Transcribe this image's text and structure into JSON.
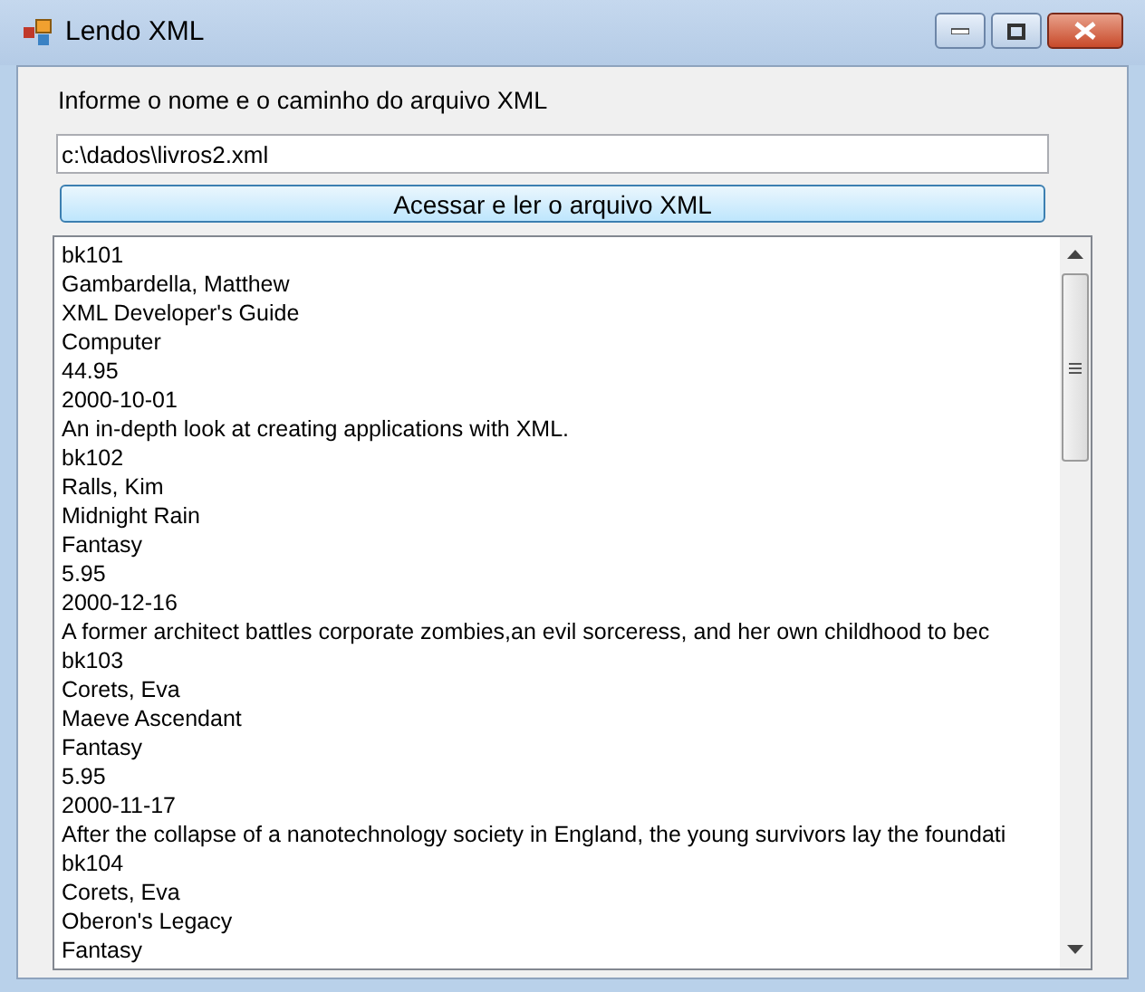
{
  "window": {
    "title": "Lendo XML"
  },
  "prompt_label": "Informe o nome e o caminho do arquivo XML",
  "path_field": {
    "value": "c:\\dados\\livros2.xml"
  },
  "read_button": {
    "label": "Acessar e ler o arquivo XML"
  },
  "list_lines": [
    "bk101",
    "Gambardella, Matthew",
    "XML Developer's Guide",
    "Computer",
    "44.95",
    "2000-10-01",
    "An in-depth look at creating applications with XML.",
    "bk102",
    "Ralls, Kim",
    "Midnight Rain",
    "Fantasy",
    "5.95",
    "2000-12-16",
    "A former architect battles corporate zombies,an evil sorceress, and her own childhood to bec",
    "bk103",
    "Corets, Eva",
    "Maeve Ascendant",
    "Fantasy",
    "5.95",
    "2000-11-17",
    "After the collapse of a nanotechnology society in England, the young survivors lay the foundati",
    "bk104",
    "Corets, Eva",
    "Oberon's Legacy",
    "Fantasy"
  ]
}
